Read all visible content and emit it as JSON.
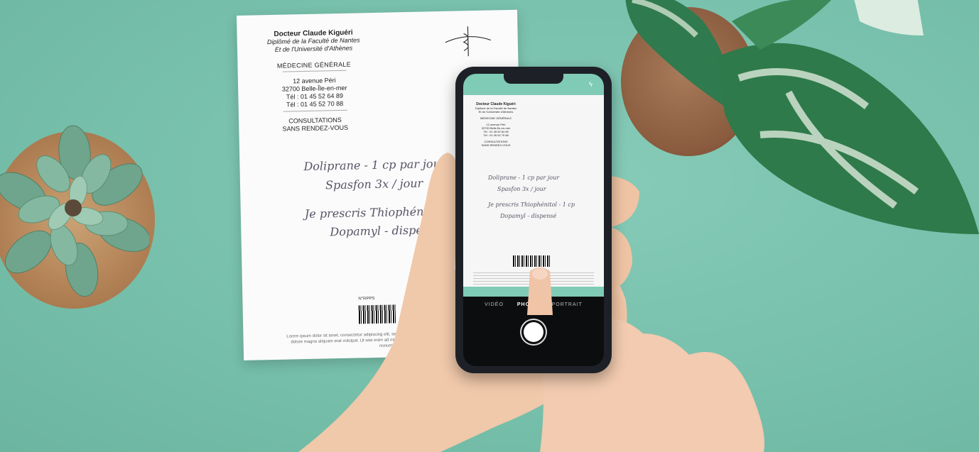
{
  "prescription": {
    "doctor": "Docteur Claude Kiguéri",
    "diploma_1": "Diplômé de la Faculté de Nantes",
    "diploma_2": "Et de l'Université d'Athènes",
    "specialty": "MÉDECINE GÉNÉRALE",
    "address_1": "12 avenue Péri",
    "address_2": "32700 Belle-Île-en-mer",
    "phone_1": "Tél : 01 45 52 64 89",
    "phone_2": "Tél : 01 45 52 70 88",
    "consult_1": "CONSULTATIONS",
    "consult_2": "SANS RENDEZ-VOUS",
    "rx_1": "Doliprane - 1 cp par jour",
    "rx_2": "Spasfon 3x / jour",
    "rx_3": "Je prescris Thiophénitol - 1 cp",
    "rx_4": "Dopamyl - dispensé",
    "barcode_id": "N°RPPS",
    "footer": "Lorem ipsum dolor sit amet, consectetur adipiscing elit, sed diam nonummy nibh euismod tincidunt ut laoreet dolore magna aliquam erat volutpat. Ut wisi enim ad minim veniam, consectetur adipiscing elit, sed diam nonummy."
  },
  "phone_app": {
    "mode_video": "VIDÉO",
    "mode_photo": "PHOTO",
    "mode_portrait": "PORTRAIT",
    "flash_icon": "flash-icon"
  },
  "colors": {
    "background": "#7cc4b0",
    "accent": "#7fcbb5",
    "paper": "#fbfbfb"
  }
}
